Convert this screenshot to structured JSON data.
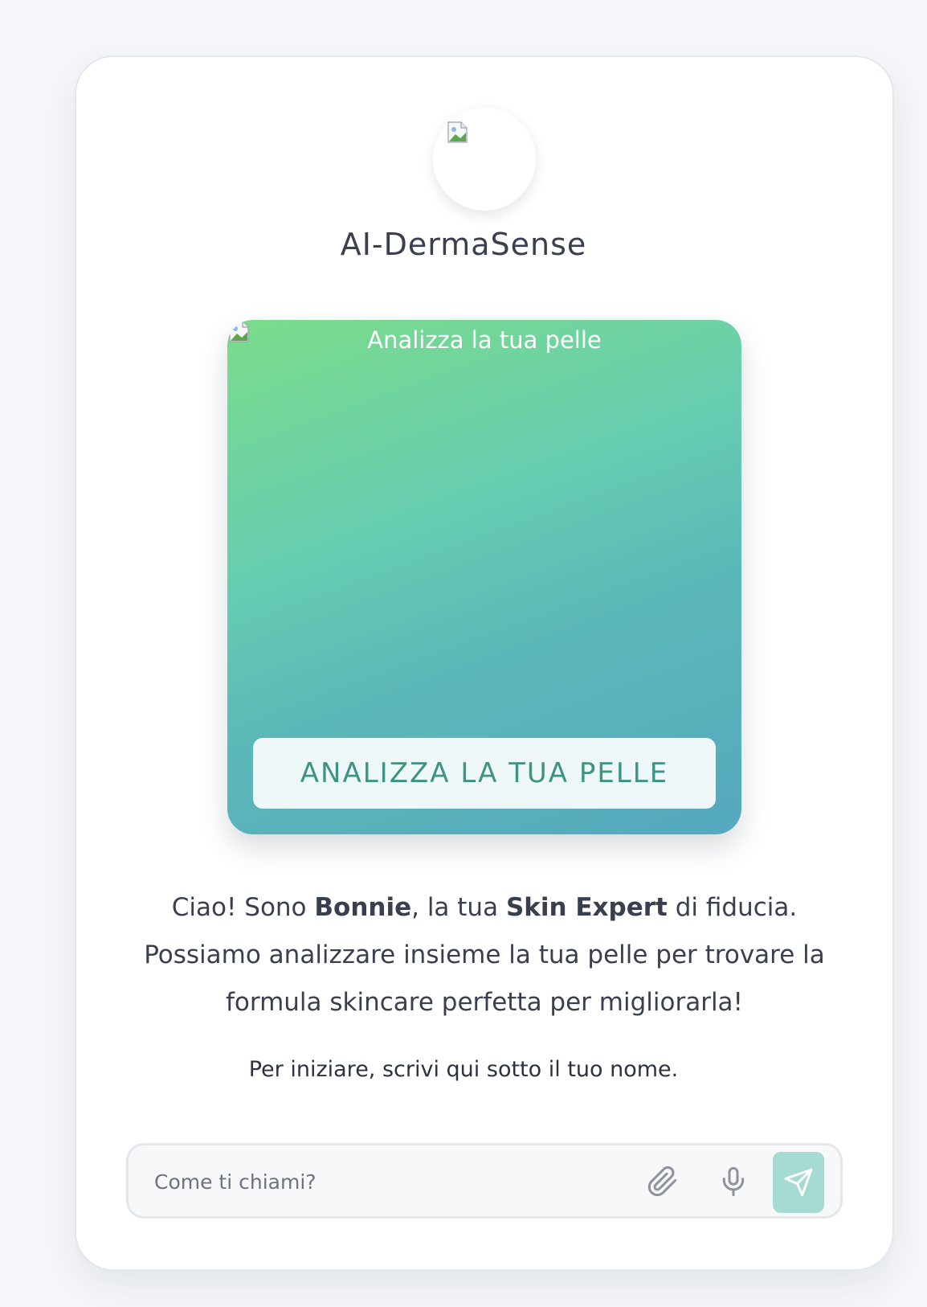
{
  "brand": {
    "name": "AI-DermaSense"
  },
  "hero": {
    "image_alt": "Analizza la tua pelle",
    "button_label": "ANALIZZA LA TUA PELLE"
  },
  "intro": {
    "greeting_prefix": "Ciao! Sono ",
    "assistant_name": "Bonnie",
    "middle": ", la tua ",
    "role": "Skin Expert",
    "suffix": " di fiducia. Possiamo analizzare insieme la tua pelle per trovare la formula skincare perfetta per migliorarla!"
  },
  "hint": "Per iniziare, scrivi qui sotto il tuo nome.",
  "chat_input": {
    "placeholder": "Come ti chiami?",
    "value": ""
  },
  "icons": {
    "avatar_image": "broken-image-icon",
    "hero_image": "broken-image-icon",
    "attach": "paperclip-icon",
    "mic": "microphone-icon",
    "send": "send-icon"
  },
  "colors": {
    "accent": "#3d9384",
    "send_button": "#a6dbd3",
    "hero_gradient_start": "#7bdc8a",
    "hero_gradient_end": "#56a8be"
  }
}
